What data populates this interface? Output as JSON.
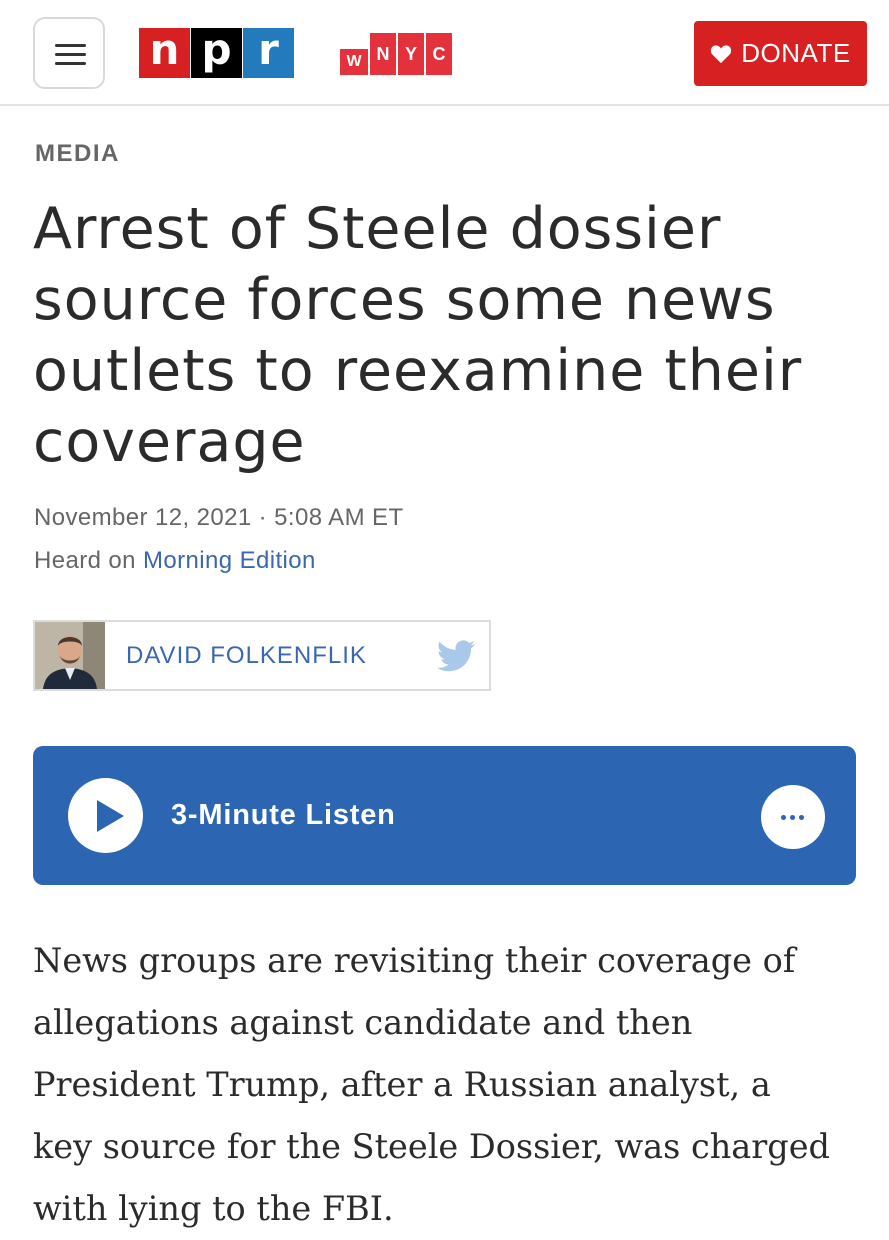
{
  "header": {
    "menu_icon": "hamburger-icon",
    "npr_logo": [
      "n",
      "p",
      "r"
    ],
    "npr_colors": [
      "#d62021",
      "#000000",
      "#237bbd"
    ],
    "wnyc_logo": [
      "W",
      "N",
      "Y",
      "C"
    ],
    "donate_label": "DONATE",
    "donate_icon": "heart-icon"
  },
  "article": {
    "section": "MEDIA",
    "headline": "Arrest of Steele dossier source forces some news outlets to reexamine their coverage",
    "dateline": "November 12, 2021 · 5:08 AM ET",
    "heard_on_prefix": "Heard on ",
    "heard_on_show": "Morning Edition",
    "author": {
      "name": "DAVID FOLKENFLIK",
      "social_icon": "twitter-icon"
    },
    "player": {
      "play_icon": "play-icon",
      "label": "3-Minute Listen",
      "more_icon": "more-options-icon"
    },
    "body": "News groups are revisiting their coverage of allegations against candidate and then President Trump, after a Russian analyst, a key source for the Steele Dossier, was charged with lying to the FBI."
  },
  "colors": {
    "donate": "#d62021",
    "player": "#2c65b2",
    "link": "#3a67b0",
    "wnyc": "#e3323b"
  }
}
